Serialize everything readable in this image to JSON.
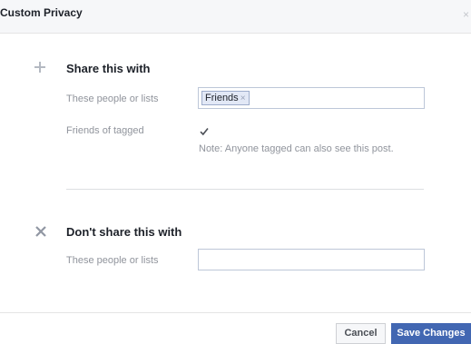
{
  "dialog": {
    "title": "Custom Privacy",
    "close_label": "×"
  },
  "share_section": {
    "heading": "Share this with",
    "icon": "plus-icon",
    "people_label": "These people or lists",
    "tokens": [
      {
        "label": "Friends",
        "remove_label": "×"
      }
    ],
    "friends_of_tagged_label": "Friends of tagged",
    "friends_of_tagged_checked": true,
    "note": "Note: Anyone tagged can also see this post."
  },
  "dont_share_section": {
    "heading": "Don't share this with",
    "icon": "cross-icon",
    "people_label": "These people or lists",
    "input_value": ""
  },
  "footer": {
    "cancel_label": "Cancel",
    "save_label": "Save Changes"
  },
  "colors": {
    "primary_button": "#4267b2",
    "token_bg": "#e2e8f6",
    "muted_text": "#90949c"
  }
}
